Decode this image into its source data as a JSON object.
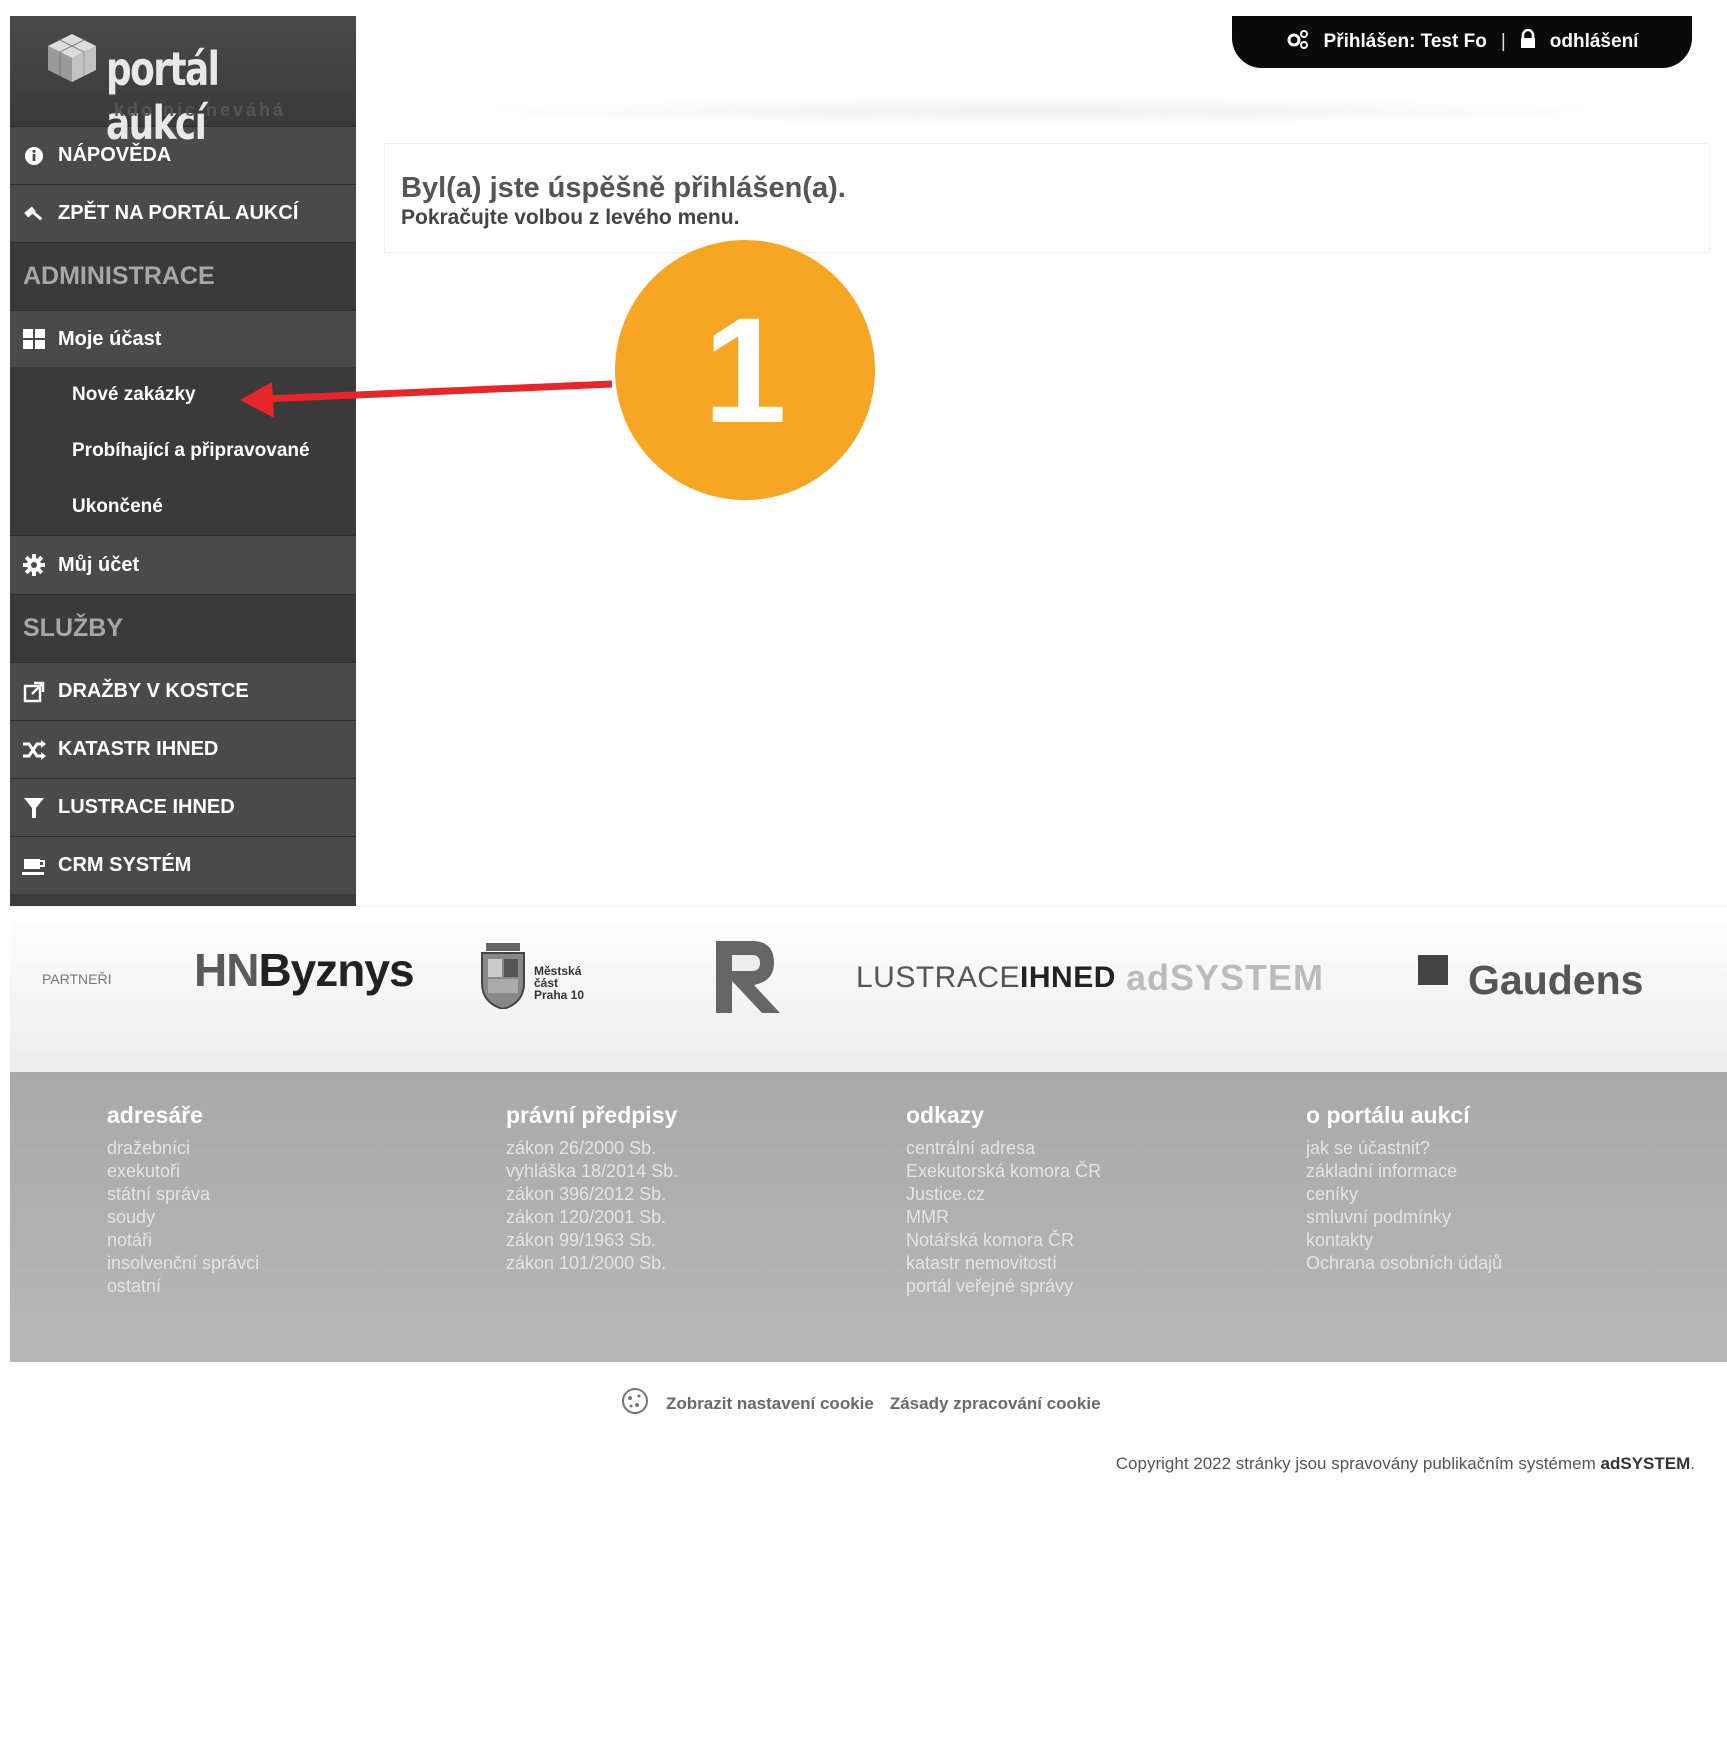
{
  "brand": {
    "logo_text": "portál aukcí",
    "logo_tagline": "kdo nic neváhá"
  },
  "sidebar": {
    "top_items": [
      {
        "label": "NÁPOVĚDA",
        "icon": "info-icon"
      },
      {
        "label": "ZPĚT NA PORTÁL AUKCÍ",
        "icon": "gavel-icon"
      }
    ],
    "admin_header": "ADMINISTRACE",
    "moje_ucast": {
      "label": "Moje účast",
      "icon": "grid-icon"
    },
    "sub_items": [
      {
        "label": "Nové zakázky"
      },
      {
        "label": "Probíhající a připravované"
      },
      {
        "label": "Ukončené"
      }
    ],
    "muj_ucet": {
      "label": "Můj účet",
      "icon": "gear-icon"
    },
    "services_header": "SLUŽBY",
    "services": [
      {
        "label": "DRAŽBY V KOSTCE",
        "icon": "external-link-icon"
      },
      {
        "label": "KATASTR IHNED",
        "icon": "shuffle-icon"
      },
      {
        "label": "LUSTRACE IHNED",
        "icon": "filter-icon"
      },
      {
        "label": "CRM SYSTÉM",
        "icon": "coffee-icon"
      }
    ]
  },
  "userbar": {
    "logged_in": "Přihlášen: Test Fo",
    "separator": "|",
    "logout": "odhlášení"
  },
  "message": {
    "title": "Byl(a) jste úspěšně přihlášen(a).",
    "subtitle": "Pokračujte volbou z levého menu."
  },
  "annotation": {
    "number": "1",
    "color": "#f7a623",
    "arrow_color": "#e8262a"
  },
  "partners": {
    "label": "PARTNEŘI",
    "hnbyznys_hn": "HN",
    "hnbyznys_byznys": "Byznys",
    "praha_text": [
      "Městská",
      "část",
      "Praha 10"
    ],
    "lustrace_a": "LUSTRACE",
    "lustrace_b": "IHNED",
    "adsystem": "adSYSTEM",
    "gaudens": "Gaudens"
  },
  "footer": {
    "columns": [
      {
        "title": "adresáře",
        "links": [
          "dražebníci",
          "exekutoři",
          "státní správa",
          "soudy",
          "notáři",
          "insolvenční správci",
          "ostatní"
        ]
      },
      {
        "title": "právní předpisy",
        "links": [
          "zákon 26/2000 Sb.",
          "vyhláška 18/2014 Sb.",
          "zákon 396/2012 Sb.",
          "zákon 120/2001 Sb.",
          "zákon 99/1963 Sb.",
          "zákon 101/2000 Sb."
        ]
      },
      {
        "title": "odkazy",
        "links": [
          "centrální adresa",
          "Exekutorská komora ČR",
          "Justice.cz",
          "MMR",
          "Notářská komora ČR",
          "katastr nemovitostí",
          "portál veřejné správy"
        ]
      },
      {
        "title": "o portálu aukcí",
        "links": [
          "jak se účastnit?",
          "základní informace",
          "ceníky",
          "smluvní podmínky",
          "kontakty",
          "Ochrana osobních údajů"
        ]
      }
    ]
  },
  "bottom": {
    "cookie_settings": "Zobrazit nastavení cookie",
    "cookie_policy": "Zásady zpracování cookie",
    "copyright_text": "Copyright 2022 stránky jsou spravovány publikačním systémem",
    "copyright_brand": "adSYSTEM",
    "copyright_end": "."
  }
}
